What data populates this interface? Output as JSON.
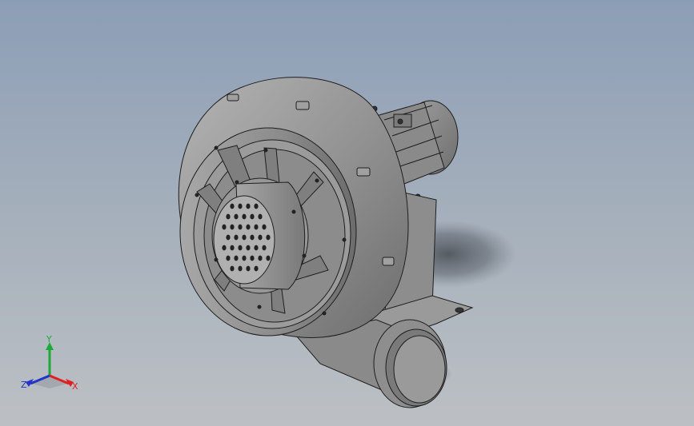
{
  "viewport": {
    "background_top": "#8c9eb6",
    "background_bottom": "#bcc0c4"
  },
  "model": {
    "part_color": "#8f8f8f",
    "edge_color": "#1e1e1e"
  },
  "triad": {
    "x_label": "X",
    "y_label": "Y",
    "z_label": "Z",
    "x_color": "#e02020",
    "y_color": "#1fa83a",
    "z_color": "#2433c8"
  }
}
